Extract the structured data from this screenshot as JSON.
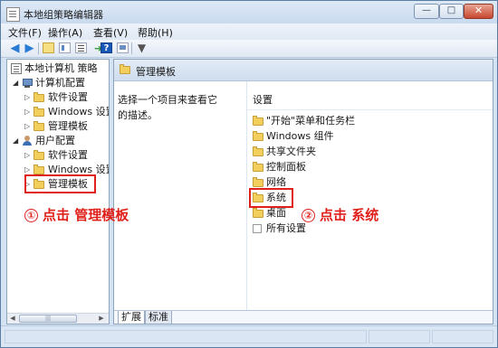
{
  "window": {
    "title": "本地组策略编辑器"
  },
  "menubar": {
    "items": [
      {
        "label": "文件(F)"
      },
      {
        "label": "操作(A)"
      },
      {
        "label": "查看(V)"
      },
      {
        "label": "帮助(H)"
      }
    ]
  },
  "toolbar": {
    "icons": [
      "back-arrow-icon",
      "forward-arrow-icon",
      "up-folder-icon",
      "show-tree-icon",
      "list-view-icon",
      "export-list-icon",
      "help-icon",
      "properties-icon",
      "filter-icon"
    ]
  },
  "tree": {
    "root": "本地计算机 策略",
    "computer_config": "计算机配置",
    "cc_software": "软件设置",
    "cc_windows": "Windows 设置",
    "cc_admin": "管理模板",
    "user_config": "用户配置",
    "uc_software": "软件设置",
    "uc_windows": "Windows 设置",
    "uc_admin": "管理模板"
  },
  "right_pane": {
    "header": "管理模板",
    "description": "选择一个项目来查看它的描述。",
    "column_header": "设置",
    "items": [
      {
        "label": "\"开始\"菜单和任务栏"
      },
      {
        "label": "Windows 组件"
      },
      {
        "label": "共享文件夹"
      },
      {
        "label": "控制面板"
      },
      {
        "label": "网络"
      },
      {
        "label": "系统"
      },
      {
        "label": "桌面"
      },
      {
        "label": "所有设置"
      }
    ],
    "tabs": [
      {
        "label": "扩展"
      },
      {
        "label": "标准"
      }
    ]
  },
  "annotations": {
    "step1_num": "①",
    "step1_text": "点击 管理模板",
    "step2_num": "②",
    "step2_text": "点击 系统",
    "color": "#e0201a"
  }
}
